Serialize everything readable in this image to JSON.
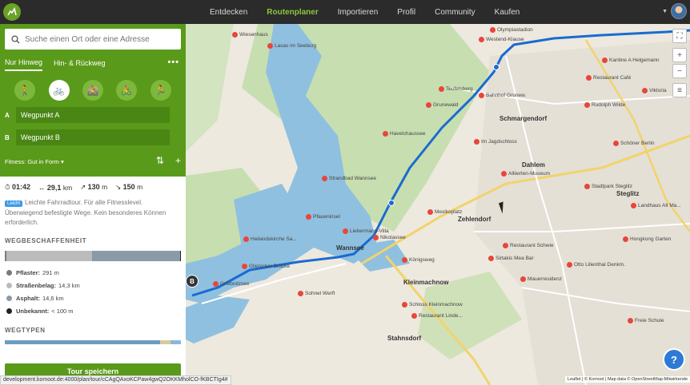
{
  "nav": {
    "items": [
      {
        "label": "Entdecken",
        "active": false
      },
      {
        "label": "Routenplaner",
        "active": true
      },
      {
        "label": "Importieren",
        "active": false
      },
      {
        "label": "Profil",
        "active": false
      },
      {
        "label": "Community",
        "active": false
      },
      {
        "label": "Kaufen",
        "active": false
      }
    ]
  },
  "search": {
    "placeholder": "Suche einen Ort oder eine Adresse"
  },
  "tabs": {
    "one_way": "Nur Hinweg",
    "round_trip": "Hin- & Rückweg",
    "more": "•••"
  },
  "sports": [
    {
      "icon": "hiking-icon",
      "glyph": "🚶",
      "active": false
    },
    {
      "icon": "bike-touring-icon",
      "glyph": "🚲",
      "active": true
    },
    {
      "icon": "mountainbike-icon",
      "glyph": "🚵",
      "active": false
    },
    {
      "icon": "road-bike-icon",
      "glyph": "🚴",
      "active": false
    },
    {
      "icon": "running-icon",
      "glyph": "🏃",
      "active": false
    }
  ],
  "waypoints": [
    {
      "letter": "A",
      "label": "Wegpunkt A"
    },
    {
      "letter": "B",
      "label": "Wegpunkt B"
    }
  ],
  "fitness": {
    "label": "Fitness: Gut in Form ▾"
  },
  "stats": {
    "duration": "01:42",
    "distance": "29,1",
    "distance_unit": "km",
    "ascent": "130",
    "ascent_unit": "m",
    "descent": "150",
    "descent_unit": "m"
  },
  "difficulty": {
    "badge": "Leicht",
    "text": "Leichte Fahrradtour. Für alle Fitnesslevel. Überwiegend befestigte Wege. Kein besonderes Können erforderlich."
  },
  "surface": {
    "heading": "WEGBESCHAFFENHEIT",
    "items": [
      {
        "name": "Pflaster:",
        "value": "291 m",
        "color": "#7a7a7a",
        "km": 0.291
      },
      {
        "name": "Straßenbelag:",
        "value": "14,3 km",
        "color": "#bbbbbb",
        "km": 14.3
      },
      {
        "name": "Asphalt:",
        "value": "14,6 km",
        "color": "#8a9aa8",
        "km": 14.6
      },
      {
        "name": "Unbekannt:",
        "value": "< 100 m",
        "color": "#222222",
        "km": 0.05
      }
    ]
  },
  "waytypes": {
    "heading": "WEGTYPEN"
  },
  "save_button": "Tour speichern",
  "status_url": "development.komoot.de:4000/plan/tour/cCAgQAxoKCPaw4gwQ2OKKMholCO-fKBCTIg4#",
  "map": {
    "attribution": "Leaflet | © Komoot | Map data © OpenStreetMap-Mitwirkende",
    "marker_b": "B",
    "help": "?",
    "places": [
      "Kleinmachnow",
      "Stahnsdorf",
      "Zehlendorf",
      "Dahlem",
      "Schmargendorf",
      "Wannsee",
      "Steglitz"
    ],
    "pois": [
      "Wiesenhaus",
      "Lasas im Seeburg",
      "Havelchaussee",
      "Grunewald",
      "Teufelsberg",
      "Mexikoplatz",
      "Alliierten-Museum",
      "Pfaueninsel",
      "Heilandskirche Sa...",
      "Liebermann-Villa",
      "Nikolassee",
      "Königsweg",
      "Schloss Kleinmachnow",
      "Restaurant Linde...",
      "Freie Schule",
      "Olympiastadion",
      "Westend-Klause",
      "Kantine A Helgemann",
      "Restaurant Café",
      "Rudolph Wilde",
      "Viktoria",
      "Schöner Berlin",
      "Stadtpark Steglitz",
      "Landhaus Alt Ma...",
      "Hongkong Garten",
      "Sirtakis Mea Bar",
      "Otto Lilienthal Denkm.",
      "Restaurant Schwie",
      "Mauerresidenz",
      "Sohnel Werft",
      "Griebnitzsee",
      "Glienicker Brücke",
      "Strandbad Wannsee",
      "Im Jagdschloss",
      "Bahnhof Grunew."
    ]
  }
}
